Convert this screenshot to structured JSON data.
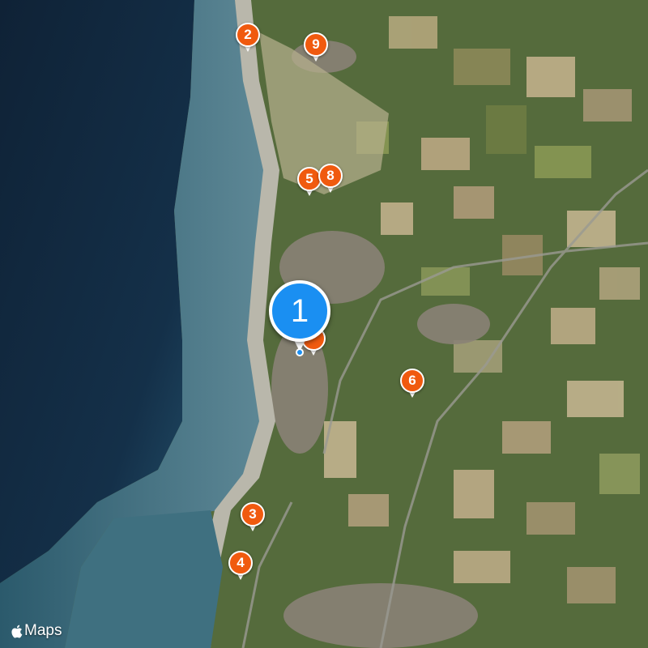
{
  "attribution": {
    "label": "Maps",
    "icon": "apple-logo-icon"
  },
  "selected_marker": {
    "label": "1",
    "color": "#1a8ff2"
  },
  "markers": [
    {
      "label": "2",
      "color": "#f05a0f"
    },
    {
      "label": "9",
      "color": "#f05a0f"
    },
    {
      "label": "5",
      "color": "#f05a0f"
    },
    {
      "label": "8",
      "color": "#f05a0f"
    },
    {
      "label": "6",
      "color": "#f05a0f"
    },
    {
      "label": "3",
      "color": "#f05a0f"
    },
    {
      "label": "4",
      "color": "#f05a0f"
    },
    {
      "label": "",
      "color": "#f05a0f"
    }
  ],
  "user_location": {
    "color": "#1a8ff2"
  }
}
